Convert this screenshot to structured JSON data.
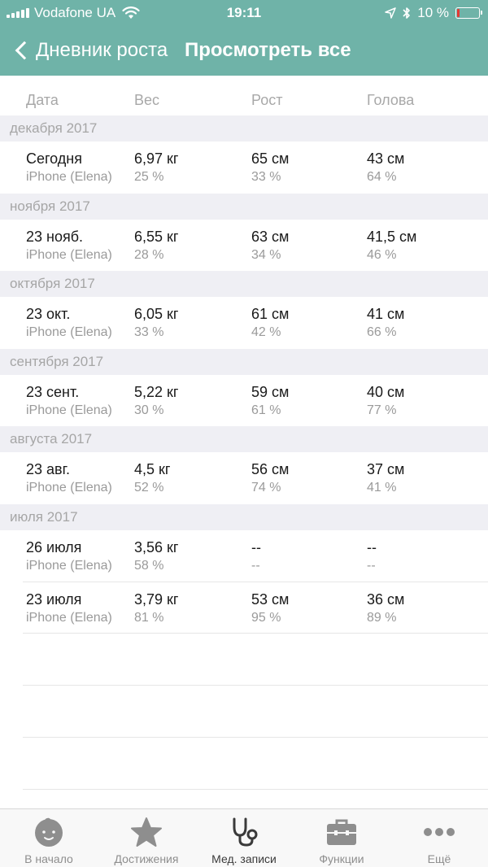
{
  "status_bar": {
    "carrier": "Vodafone UA",
    "time": "19:11",
    "battery_percent": "10 %",
    "battery_level": 0.1
  },
  "navbar": {
    "back_label": "Дневник роста",
    "title": "Просмотреть все"
  },
  "columns": [
    "Дата",
    "Вес",
    "Рост",
    "Голова"
  ],
  "sections": [
    {
      "header": "декабря 2017",
      "entries": [
        {
          "date": "Сегодня",
          "source": "iPhone (Elena)",
          "weight": "6,97 кг",
          "weight_pct": "25 %",
          "height": "65 см",
          "height_pct": "33 %",
          "head": "43 см",
          "head_pct": "64 %"
        }
      ]
    },
    {
      "header": "ноября 2017",
      "entries": [
        {
          "date": "23 нояб.",
          "source": "iPhone (Elena)",
          "weight": "6,55 кг",
          "weight_pct": "28 %",
          "height": "63 см",
          "height_pct": "34 %",
          "head": "41,5 см",
          "head_pct": "46 %"
        }
      ]
    },
    {
      "header": "октября 2017",
      "entries": [
        {
          "date": "23 окт.",
          "source": "iPhone (Elena)",
          "weight": "6,05 кг",
          "weight_pct": "33 %",
          "height": "61 см",
          "height_pct": "42 %",
          "head": "41 см",
          "head_pct": "66 %"
        }
      ]
    },
    {
      "header": "сентября 2017",
      "entries": [
        {
          "date": "23 сент.",
          "source": "iPhone (Elena)",
          "weight": "5,22 кг",
          "weight_pct": "30 %",
          "height": "59 см",
          "height_pct": "61 %",
          "head": "40 см",
          "head_pct": "77 %"
        }
      ]
    },
    {
      "header": "августа 2017",
      "entries": [
        {
          "date": "23 авг.",
          "source": "iPhone (Elena)",
          "weight": "4,5 кг",
          "weight_pct": "52 %",
          "height": "56 см",
          "height_pct": "74 %",
          "head": "37 см",
          "head_pct": "41 %"
        }
      ]
    },
    {
      "header": "июля 2017",
      "entries": [
        {
          "date": "26 июля",
          "source": "iPhone (Elena)",
          "weight": "3,56 кг",
          "weight_pct": "58 %",
          "height": "--",
          "height_pct": "--",
          "head": "--",
          "head_pct": "--"
        },
        {
          "date": "23 июля",
          "source": "iPhone (Elena)",
          "weight": "3,79 кг",
          "weight_pct": "81 %",
          "height": "53 см",
          "height_pct": "95 %",
          "head": "36 см",
          "head_pct": "89 %"
        }
      ]
    }
  ],
  "tabbar": {
    "items": [
      {
        "label": "В начало",
        "icon": "baby-face-icon"
      },
      {
        "label": "Достижения",
        "icon": "star-icon"
      },
      {
        "label": "Мед. записи",
        "icon": "stethoscope-icon",
        "active": true
      },
      {
        "label": "Функции",
        "icon": "toolbox-icon"
      },
      {
        "label": "Ещё",
        "icon": "more-dots-icon"
      }
    ]
  },
  "colors": {
    "header_bg": "#6fb3a8",
    "section_bg": "#efeff4",
    "battery_low": "#e53935"
  }
}
